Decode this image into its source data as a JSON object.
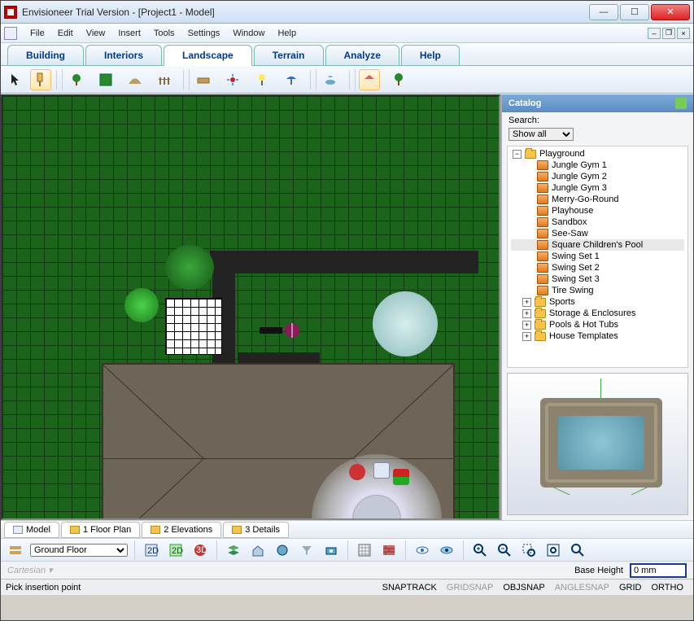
{
  "window": {
    "title": "Envisioneer Trial Version - [Project1 - Model]"
  },
  "menu": {
    "items": [
      "File",
      "Edit",
      "View",
      "Insert",
      "Tools",
      "Settings",
      "Window",
      "Help"
    ]
  },
  "mainTabs": {
    "items": [
      "Building",
      "Interiors",
      "Landscape",
      "Terrain",
      "Analyze",
      "Help"
    ],
    "active": "Landscape"
  },
  "catalog": {
    "title": "Catalog",
    "searchLabel": "Search:",
    "searchValue": "Show all",
    "root": "Playground",
    "items": [
      "Jungle Gym 1",
      "Jungle Gym 2",
      "Jungle Gym 3",
      "Merry-Go-Round",
      "Playhouse",
      "Sandbox",
      "See-Saw",
      "Square Children's Pool",
      "Swing Set 1",
      "Swing Set 2",
      "Swing Set 3",
      "Tire Swing"
    ],
    "selected": "Square Children's Pool",
    "otherFolders": [
      "Sports",
      "Storage & Enclosures",
      "Pools & Hot Tubs",
      "House Templates"
    ]
  },
  "viewTabs": {
    "items": [
      "Model",
      "1 Floor Plan",
      "2 Elevations",
      "3 Details"
    ]
  },
  "floorSelect": "Ground Floor",
  "coord": {
    "mode": "Cartesian"
  },
  "baseHeight": {
    "label": "Base Height",
    "value": "0 mm"
  },
  "status": {
    "prompt": "Pick insertion point"
  },
  "snaps": {
    "items": [
      "SNAPTRACK",
      "GRIDSNAP",
      "OBJSNAP",
      "ANGLESNAP",
      "GRID",
      "ORTHO"
    ],
    "on": [
      "SNAPTRACK",
      "OBJSNAP",
      "GRID",
      "ORTHO"
    ]
  },
  "colors": {
    "accent": "#5a8cc4",
    "grass": "#1c641c"
  }
}
